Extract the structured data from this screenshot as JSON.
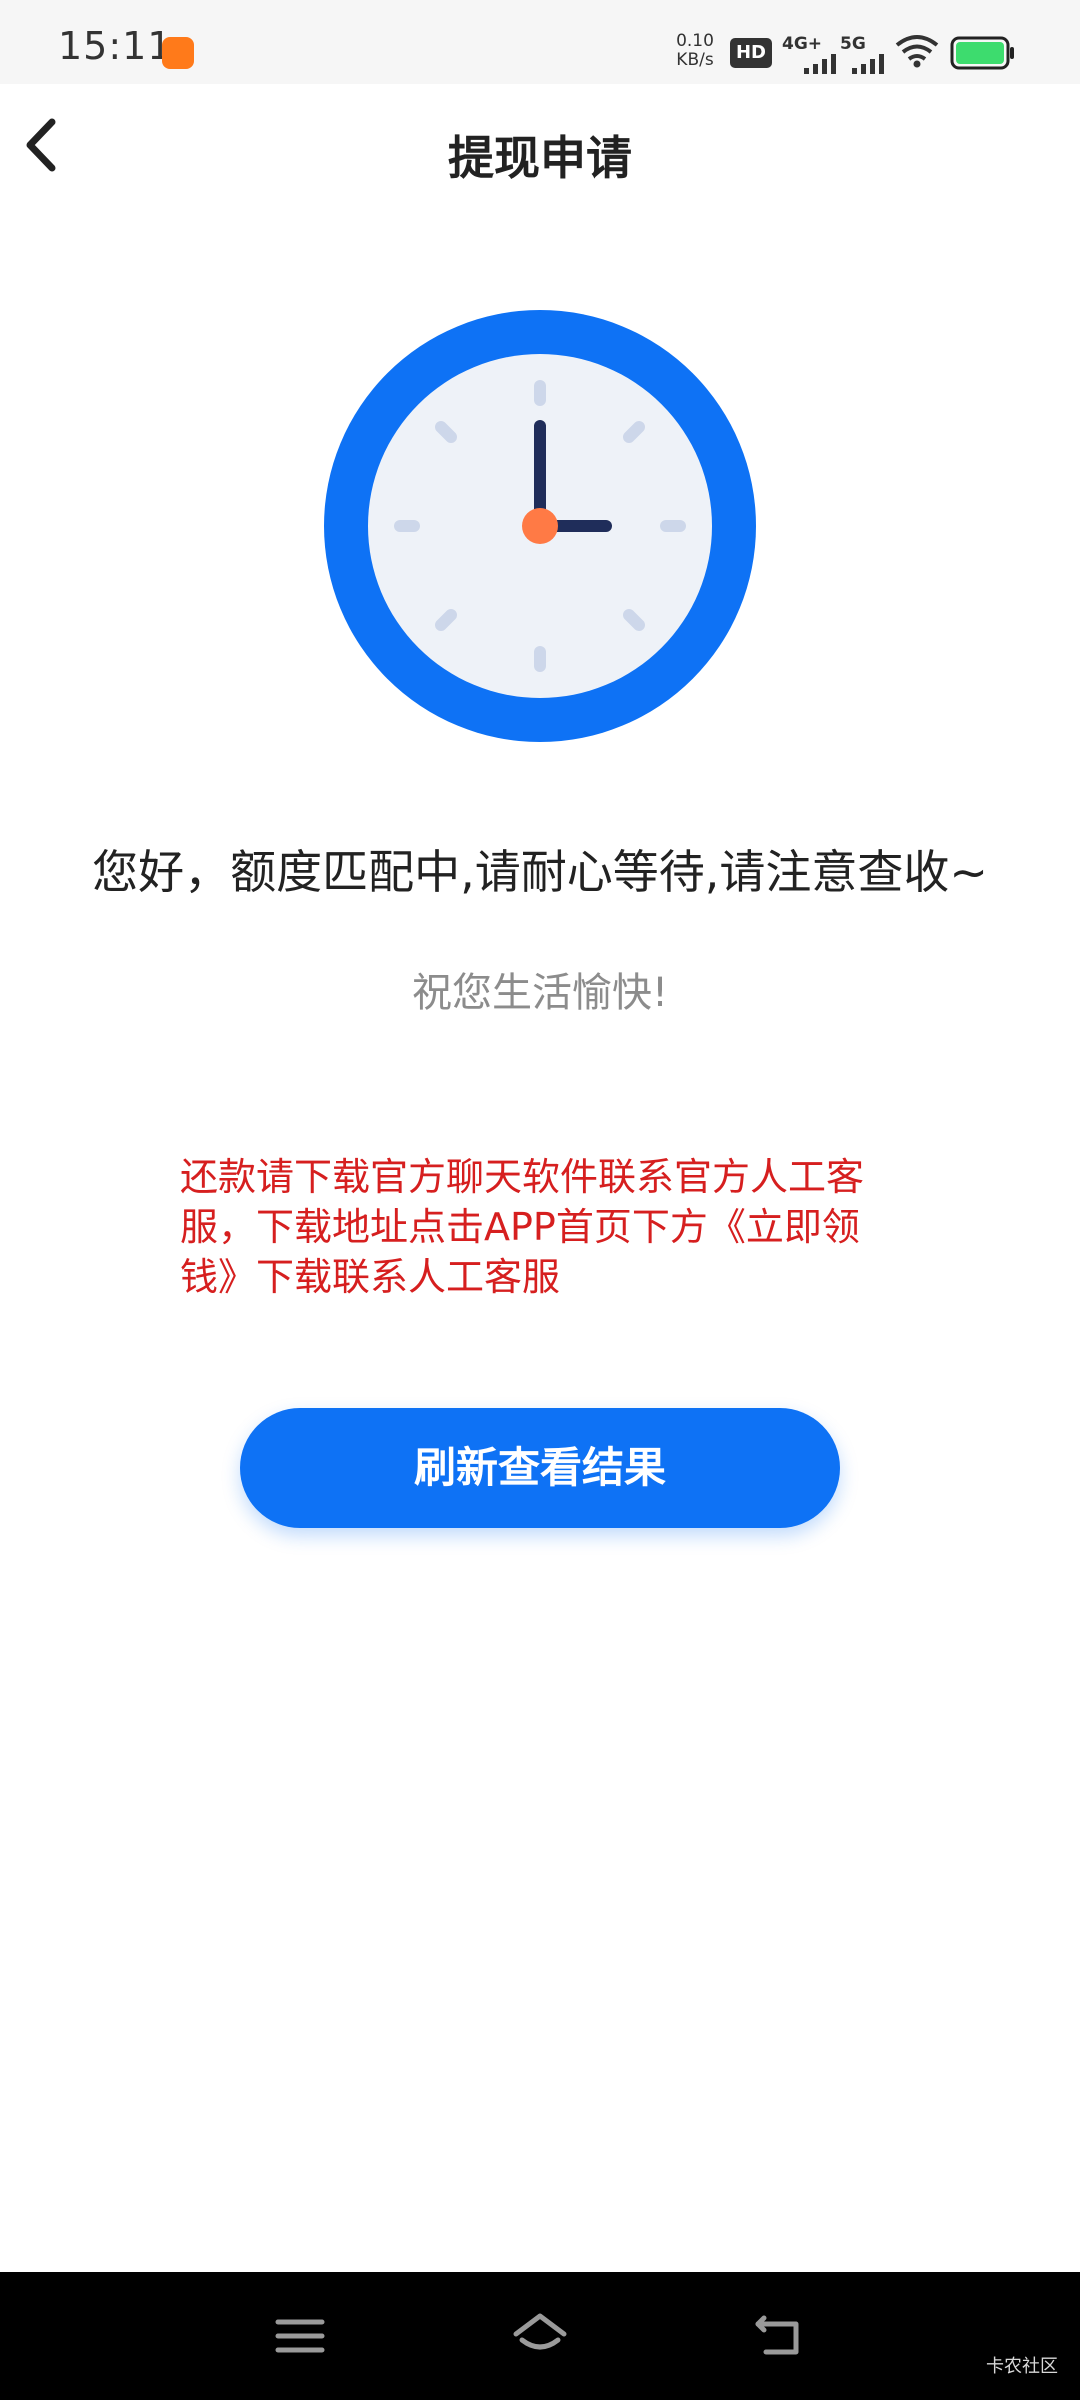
{
  "status_bar": {
    "time": "15:11",
    "net_speed_value": "0.10",
    "net_speed_unit": "KB/s",
    "hd_label": "HD",
    "sim_label_1": "4G+",
    "sim_label_2": "5G",
    "icons": [
      "app-notification-icon",
      "hd-icon",
      "signal-icon",
      "wifi-icon",
      "battery-icon"
    ]
  },
  "header": {
    "title": "提现申请",
    "back_icon": "chevron-left-icon"
  },
  "content": {
    "illustration": "clock-icon",
    "message": "您好，额度匹配中,请耐心等待,请注意查收~",
    "wish": "祝您生活愉快!",
    "notice": "还款请下载官方聊天软件联系官方人工客服，下载地址点击APP首页下方《立即领钱》下载联系人工客服",
    "button_label": "刷新查看结果"
  },
  "navbar": {
    "icons": [
      "menu-icon",
      "home-icon",
      "back-icon"
    ]
  },
  "watermark": "卡农社区",
  "colors": {
    "accent": "#0e72f5",
    "notice_red": "#d61f1f",
    "clock_face": "#eef2f8",
    "clock_center": "#ff7a45"
  }
}
